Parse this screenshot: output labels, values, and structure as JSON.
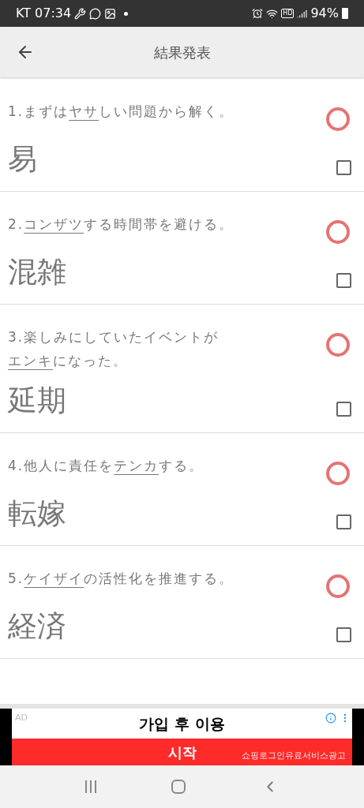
{
  "status_bar": {
    "carrier_time": "KT 07:34",
    "hd": "HD",
    "battery": "94%"
  },
  "header": {
    "title": "結果発表"
  },
  "questions": [
    {
      "number": "1.",
      "before": "まずは",
      "underlined": "ヤサ",
      "after": "しい問題から解く。",
      "line_break": false,
      "answer": "易",
      "correct": true,
      "checked": false
    },
    {
      "number": "2.",
      "underlined": "コンザツ",
      "after": "する時間帯を避ける。",
      "line_break": false,
      "answer": "混雑",
      "correct": true,
      "checked": false
    },
    {
      "number": "3.",
      "before": "楽しみにしていたイベントが",
      "underlined": "エンキ",
      "after": "になった。",
      "line_break": true,
      "answer": "延期",
      "correct": true,
      "checked": false
    },
    {
      "number": "4.",
      "before": "他人に責任を",
      "underlined": "テンカ",
      "after": "する。",
      "line_break": false,
      "answer": "転嫁",
      "correct": true,
      "checked": false
    },
    {
      "number": "5.",
      "underlined": "ケイザイ",
      "after": "の活性化を推進する。",
      "line_break": false,
      "answer": "経済",
      "correct": true,
      "checked": false
    }
  ],
  "ad": {
    "label": "AD",
    "headline": "가입 후 이용",
    "cta": "시작",
    "disclaimer": "쇼핑로그인유료서비스광고"
  }
}
